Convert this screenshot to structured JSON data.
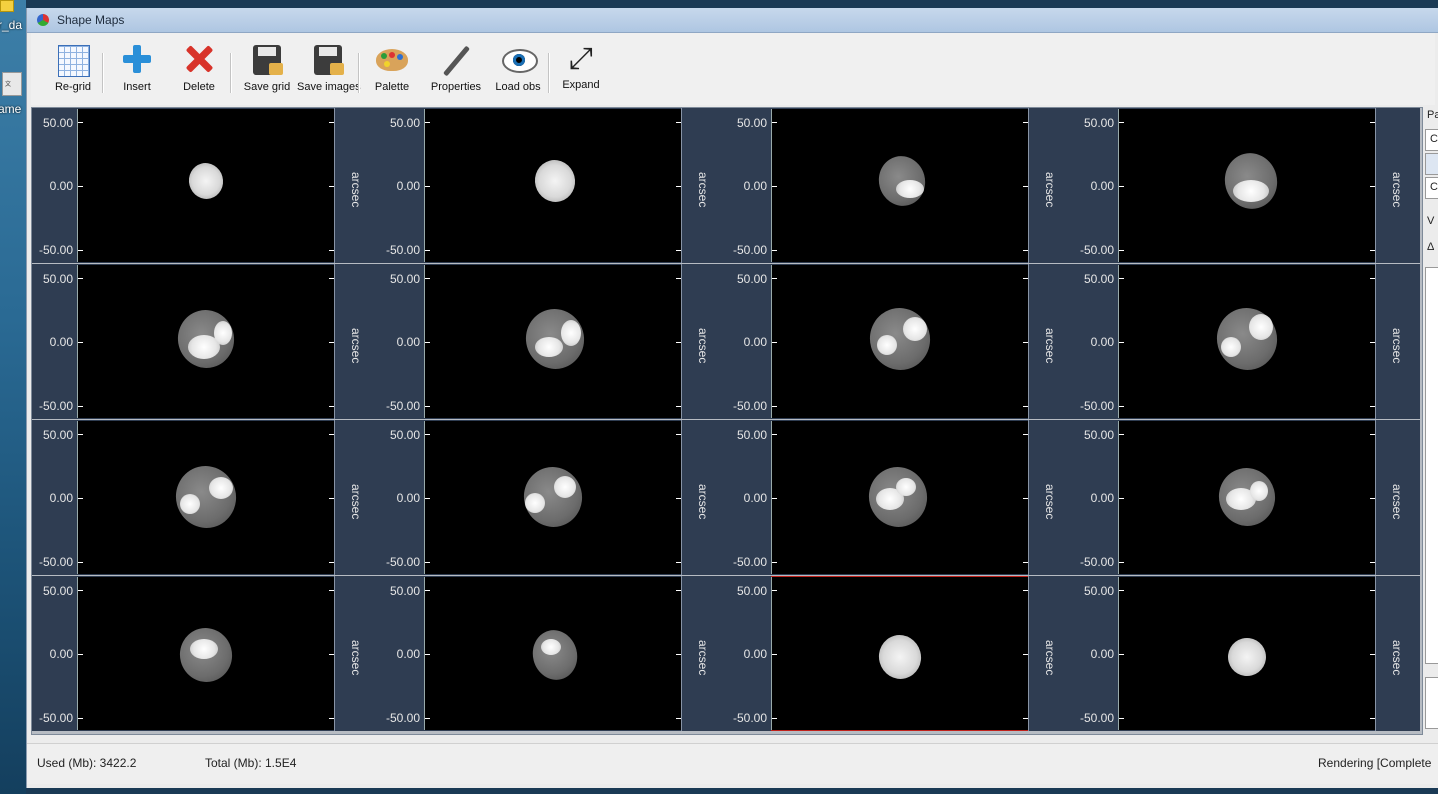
{
  "window": {
    "title": "Shape Maps"
  },
  "desktop": {
    "label_top": "r_da",
    "label_bottom": "ame"
  },
  "toolbar": {
    "regrid": "Re-grid",
    "insert": "Insert",
    "delete": "Delete",
    "save_grid": "Save grid",
    "save_images": "Save images",
    "palette": "Palette",
    "properties": "Properties",
    "load_obs": "Load obs",
    "expand": "Expand"
  },
  "plot": {
    "y_ticks": [
      "50.00",
      "0.00",
      "-50.00"
    ],
    "colorbar_label": "arcsec",
    "rows": 4,
    "cols": 4,
    "selected_cell": 14
  },
  "right_panel": {
    "chars": [
      "Pa",
      "C",
      "",
      "C",
      "V",
      "Δ"
    ]
  },
  "status": {
    "used": "Used (Mb): 3422.2",
    "total": "Total (Mb): 1.5E4",
    "rendering": "Rendering [Complete"
  },
  "colors": {
    "accent_selected": "#c0201a",
    "plot_bg": "#000000",
    "axis_bg": "#2f3d52"
  }
}
